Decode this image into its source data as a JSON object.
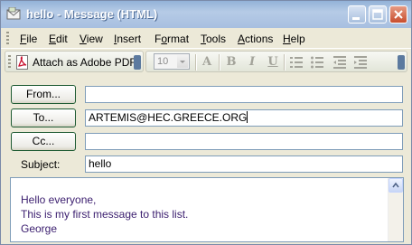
{
  "window": {
    "title": "hello - Message (HTML)"
  },
  "menu": {
    "items": [
      {
        "label": "File",
        "underline": "F",
        "rest": "ile"
      },
      {
        "label": "Edit",
        "underline": "E",
        "rest": "dit"
      },
      {
        "label": "View",
        "underline": "V",
        "rest": "iew"
      },
      {
        "label": "Insert",
        "underline": "I",
        "rest": "nsert"
      },
      {
        "label": "Format",
        "underline": "o",
        "pre": "F",
        "rest": "rmat"
      },
      {
        "label": "Tools",
        "underline": "T",
        "rest": "ools"
      },
      {
        "label": "Actions",
        "underline": "A",
        "rest": "ctions"
      },
      {
        "label": "Help",
        "underline": "H",
        "rest": "elp"
      }
    ]
  },
  "toolbar": {
    "pdf_label": "Attach as Adobe PDF",
    "font_size": "10",
    "icons": [
      "font-color-icon",
      "bold-icon",
      "italic-icon",
      "underline-icon",
      "numbered-list-icon",
      "bullet-list-icon",
      "decrease-indent-icon",
      "increase-indent-icon"
    ]
  },
  "header": {
    "from_label": "From...",
    "to_label": "To...",
    "cc_label": "Cc...",
    "subject_label": "Subject:",
    "from_value": "",
    "to_value": "ARTEMIS@HEC.GREECE.ORG",
    "cc_value": "",
    "subject_value": "hello"
  },
  "body": {
    "lines": [
      "Hello everyone,",
      "This is my first message to this list.",
      "George"
    ]
  },
  "colors": {
    "titlebar": "#a7bfe0",
    "body_text": "#3a1d6e",
    "chrome": "#ece9d8"
  }
}
